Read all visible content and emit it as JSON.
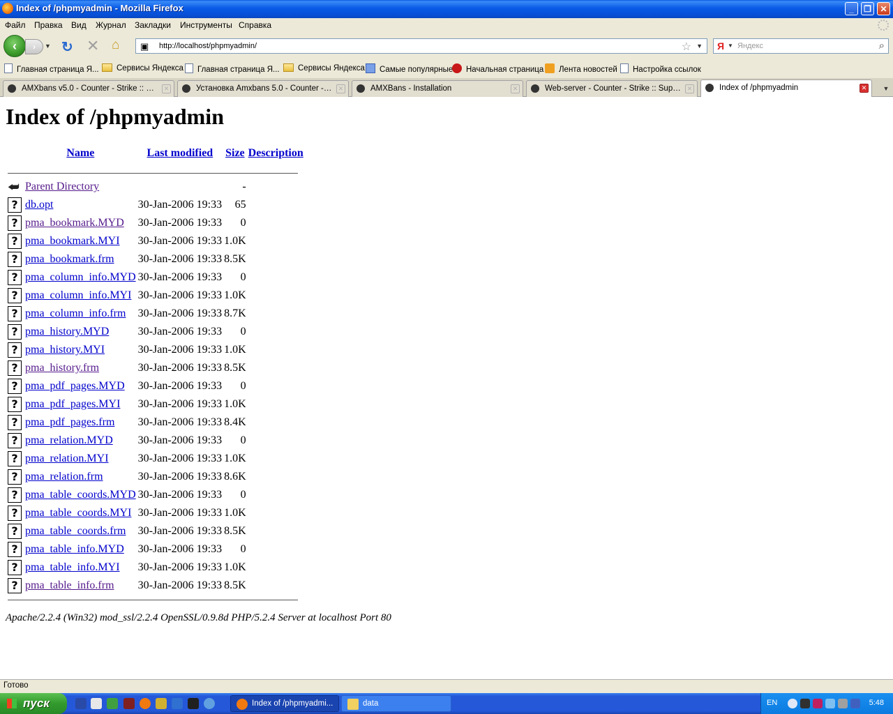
{
  "window": {
    "title": "Index of /phpmyadmin - Mozilla Firefox"
  },
  "menu": [
    "Файл",
    "Правка",
    "Вид",
    "Журнал",
    "Закладки",
    "Инструменты",
    "Справка"
  ],
  "nav": {
    "url": "http://localhost/phpmyadmin/",
    "search_placeholder": "Яндекс",
    "search_engine_label": "Я"
  },
  "bookmarks": [
    {
      "label": "Главная страница Я...",
      "icon": "page-icon"
    },
    {
      "label": "Сервисы Яндекса",
      "icon": "folder-icon"
    },
    {
      "label": "Главная страница Я...",
      "icon": "page-icon"
    },
    {
      "label": "Сервисы Яндекса",
      "icon": "folder-icon"
    },
    {
      "label": "Самые популярные",
      "icon": "popular-icon"
    },
    {
      "label": "Начальная страница",
      "icon": "yandex-icon"
    },
    {
      "label": "Лента новостей",
      "icon": "rss-icon"
    },
    {
      "label": "Настройка ссылок",
      "icon": "page-icon"
    }
  ],
  "tabs": [
    {
      "label": "AMXbans v5.0 - Counter - Strike :: Sup...",
      "active": false
    },
    {
      "label": "Установка Amxbans 5.0 - Counter - St...",
      "active": false
    },
    {
      "label": "AMXBans - Installation",
      "active": false
    },
    {
      "label": "Web-server - Counter - Strike :: Suppo...",
      "active": false
    },
    {
      "label": "Index of /phpmyadmin",
      "active": true
    }
  ],
  "page": {
    "heading": "Index of /phpmyadmin",
    "columns": {
      "name": "Name",
      "modified": "Last modified",
      "size": "Size",
      "description": "Description"
    },
    "parent": {
      "name": "Parent Directory",
      "size": "-"
    },
    "files": [
      {
        "name": "db.opt",
        "modified": "30-Jan-2006 19:33",
        "size": "65",
        "visited": false
      },
      {
        "name": "pma_bookmark.MYD",
        "modified": "30-Jan-2006 19:33",
        "size": "0",
        "visited": true
      },
      {
        "name": "pma_bookmark.MYI",
        "modified": "30-Jan-2006 19:33",
        "size": "1.0K",
        "visited": false
      },
      {
        "name": "pma_bookmark.frm",
        "modified": "30-Jan-2006 19:33",
        "size": "8.5K",
        "visited": false
      },
      {
        "name": "pma_column_info.MYD",
        "modified": "30-Jan-2006 19:33",
        "size": "0",
        "visited": false
      },
      {
        "name": "pma_column_info.MYI",
        "modified": "30-Jan-2006 19:33",
        "size": "1.0K",
        "visited": false
      },
      {
        "name": "pma_column_info.frm",
        "modified": "30-Jan-2006 19:33",
        "size": "8.7K",
        "visited": false
      },
      {
        "name": "pma_history.MYD",
        "modified": "30-Jan-2006 19:33",
        "size": "0",
        "visited": false
      },
      {
        "name": "pma_history.MYI",
        "modified": "30-Jan-2006 19:33",
        "size": "1.0K",
        "visited": false
      },
      {
        "name": "pma_history.frm",
        "modified": "30-Jan-2006 19:33",
        "size": "8.5K",
        "visited": true
      },
      {
        "name": "pma_pdf_pages.MYD",
        "modified": "30-Jan-2006 19:33",
        "size": "0",
        "visited": false
      },
      {
        "name": "pma_pdf_pages.MYI",
        "modified": "30-Jan-2006 19:33",
        "size": "1.0K",
        "visited": false
      },
      {
        "name": "pma_pdf_pages.frm",
        "modified": "30-Jan-2006 19:33",
        "size": "8.4K",
        "visited": false
      },
      {
        "name": "pma_relation.MYD",
        "modified": "30-Jan-2006 19:33",
        "size": "0",
        "visited": false
      },
      {
        "name": "pma_relation.MYI",
        "modified": "30-Jan-2006 19:33",
        "size": "1.0K",
        "visited": false
      },
      {
        "name": "pma_relation.frm",
        "modified": "30-Jan-2006 19:33",
        "size": "8.6K",
        "visited": false
      },
      {
        "name": "pma_table_coords.MYD",
        "modified": "30-Jan-2006 19:33",
        "size": "0",
        "visited": false
      },
      {
        "name": "pma_table_coords.MYI",
        "modified": "30-Jan-2006 19:33",
        "size": "1.0K",
        "visited": false
      },
      {
        "name": "pma_table_coords.frm",
        "modified": "30-Jan-2006 19:33",
        "size": "8.5K",
        "visited": false
      },
      {
        "name": "pma_table_info.MYD",
        "modified": "30-Jan-2006 19:33",
        "size": "0",
        "visited": false
      },
      {
        "name": "pma_table_info.MYI",
        "modified": "30-Jan-2006 19:33",
        "size": "1.0K",
        "visited": false
      },
      {
        "name": "pma_table_info.frm",
        "modified": "30-Jan-2006 19:33",
        "size": "8.5K",
        "visited": true
      }
    ],
    "address": "Apache/2.2.4 (Win32) mod_ssl/2.2.4 OpenSSL/0.9.8d PHP/5.2.4 Server at localhost Port 80"
  },
  "status": {
    "text": "Готово"
  },
  "taskbar": {
    "start_label": "пуск",
    "quicklaunch": [
      "word-icon",
      "notepad-icon",
      "globe-icon",
      "game-icon",
      "firefox-icon",
      "app-icon",
      "winamp-icon",
      "tool-icon",
      "ie-icon"
    ],
    "windows": [
      {
        "label": "Index of /phpmyadmi...",
        "icon": "firefox-icon",
        "active": true
      },
      {
        "label": "data",
        "icon": "folder-icon",
        "active": false
      }
    ],
    "tray": {
      "language": "EN",
      "clock": "5:48"
    }
  },
  "colors": {
    "link": "#0000cc",
    "visited_link": "#551a8b",
    "titlebar": "#0a5ae6",
    "taskbar": "#2458d8"
  }
}
